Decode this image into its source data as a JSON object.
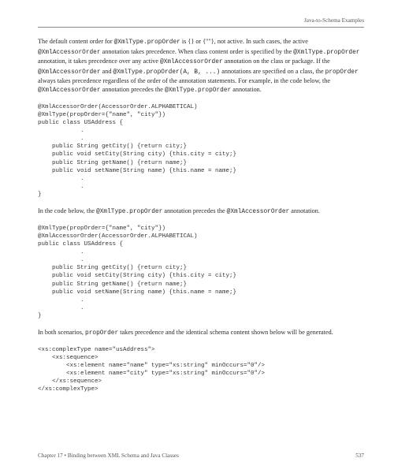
{
  "header": {
    "section_title": "Java-to-Schema Examples"
  },
  "para1_part1": "The default content order for ",
  "para1_mono1": "@XmlType.propOrder",
  "para1_part2": " is {} or {\"\"}, not active. In such cases, the active ",
  "para1_mono2": "@XmlAccessorOrder",
  "para1_part3": " annotation takes precedence. When class content order is specified by the ",
  "para1_mono3": "@XmlType.propOrder",
  "para1_part4": " annotation, it takes precedence over any active ",
  "para1_mono4": "@XmlAccessorOrder",
  "para1_part5": " annotation on the class or package. If the ",
  "para1_mono5": "@XmlAccessorOrder",
  "para1_part6": " and ",
  "para1_mono6": "@XmlType.propOrder(A, B, ...)",
  "para1_part7": " annotations are specified on a class, the ",
  "para1_mono7": "propOrder",
  "para1_part8": " always takes precedence regardless of the order of the annotation statements. For example, in the code below, the ",
  "para1_mono8": "@XmlAccessorOrder",
  "para1_part9": " annotation precedes the ",
  "para1_mono9": "@XmlType.propOrder",
  "para1_part10": " annotation.",
  "code1": "@XmlAccessorOrder(AccessorOrder.ALPHABETICAL)\n@XmlType(propOrder={\"name\", \"city\"})\npublic class USAddress {\n            .\n            .\n    public String getCity() {return city;}\n    public void setCity(String city) {this.city = city;}\n    public String getName() {return name;}\n    public void setName(String name) {this.name = name;}\n            .\n            .\n}",
  "para2_part1": "In the code below, the ",
  "para2_mono1": "@XmlType.propOrder",
  "para2_part2": " annotation precedes the ",
  "para2_mono2": "@XmlAccessorOrder",
  "para2_part3": " annotation.",
  "code2": "@XmlType(propOrder={\"name\", \"city\"})\n@XmlAccessorOrder(AccessorOrder.ALPHABETICAL)\npublic class USAddress {\n            .\n            .\n    public String getCity() {return city;}\n    public void setCity(String city) {this.city = city;}\n    public String getName() {return name;}\n    public void setName(String name) {this.name = name;}\n            .\n            .\n}",
  "para3_part1": "In both scenarios, ",
  "para3_mono1": "propOrder",
  "para3_part2": " takes precedence and the identical schema content shown below will be generated.",
  "code3": "<xs:complexType name=\"usAddress\">\n    <xs:sequence>\n        <xs:element name=\"name\" type=\"xs:string\" minOccurs=\"0\"/>\n        <xs:element name=\"city\" type=\"xs:string\" minOccurs=\"0\"/>\n    </xs:sequence>\n</xs:complexType>",
  "footer": {
    "chapter": "Chapter 17 • Binding between XML Schema and Java Classes",
    "page": "537"
  }
}
